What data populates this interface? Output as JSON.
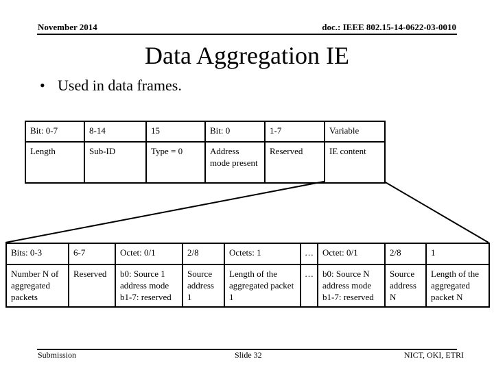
{
  "header": {
    "date": "November 2014",
    "doc_id": "doc.: IEEE 802.15-14-0622-03-0010"
  },
  "title": "Data Aggregation IE",
  "bullets": [
    "Used in data frames."
  ],
  "top_table": {
    "bits_row": [
      "Bit: 0-7",
      "8-14",
      "15",
      "Bit: 0",
      "1-7",
      "Variable"
    ],
    "field_row": [
      "Length",
      "Sub-ID",
      "Type = 0",
      "Address mode present",
      "Reserved",
      "IE content"
    ]
  },
  "bottom_table": {
    "bits_row": [
      "Bits: 0-3",
      "6-7",
      "Octet: 0/1",
      "2/8",
      "Octets: 1",
      "…",
      "Octet: 0/1",
      "2/8",
      "1"
    ],
    "field_row": [
      "Number N of aggregated packets",
      "Reserved",
      "b0: Source 1 address mode b1-7: reserved",
      "Source address 1",
      "Length of the aggregated packet 1",
      "…",
      "b0: Source N address mode b1-7: reserved",
      "Source address N",
      "Length of the aggregated packet N"
    ]
  },
  "footer": {
    "left": "Submission",
    "center": "Slide 32",
    "right": "NICT, OKI, ETRI"
  }
}
